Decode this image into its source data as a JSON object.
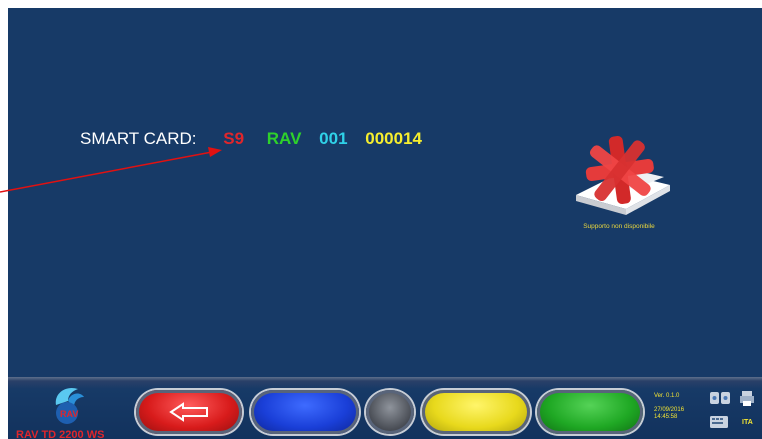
{
  "screen": {
    "smart_card": {
      "label": "SMART CARD:",
      "code_parts": [
        "S9",
        "RAV",
        "001",
        "000014"
      ]
    },
    "status_icon": "card-unavailable-icon",
    "status_text": "Supporto non disponibile"
  },
  "toolbar": {
    "logo_text": "RAV TD 2200 WS",
    "buttons": [
      {
        "name": "back",
        "color": "#d81b1b",
        "icon": "back-arrow-icon"
      },
      {
        "name": "blue",
        "color": "#1a3fd8"
      },
      {
        "name": "grey",
        "color": "#4b4f57"
      },
      {
        "name": "yellow",
        "color": "#e8d91c"
      },
      {
        "name": "green",
        "color": "#1fa824"
      }
    ],
    "version": "Ver. 0.1.0",
    "date": "27/09/2016",
    "time": "14:45:58",
    "language": "ITA"
  },
  "annotation": {
    "arrow_color": "#e11111",
    "arrow_icon": "pointer-arrow-icon"
  }
}
